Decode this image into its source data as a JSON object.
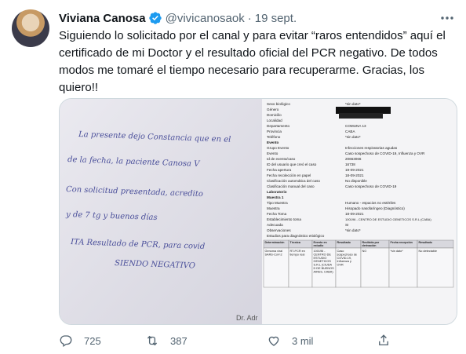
{
  "tweet": {
    "author_name": "Viviana Canosa",
    "handle": "@vivicanosaok",
    "separator": "·",
    "date": "19 sept.",
    "text": "Siguiendo lo solicitado por el canal y para evitar “raros entendidos” aquí el certificado de mi Doctor y el resultado oficial del PCR negativo. De todos modos me tomaré el tiempo necesario para recuperarme. Gracias, los quiero!!"
  },
  "media": {
    "handwriting_lines": [
      "La presente dejo Constancia que en el",
      "de la fecha, la paciente Canosa V",
      "Con solicitud presentada, acredito",
      "y de 7 tg y buenos días",
      "ITA Resultado de PCR, para covid",
      "SIENDO NEGATIVO"
    ],
    "signature": "Dr. Adr",
    "report": {
      "fields_top": [
        {
          "label": "Sexo biológico",
          "value": "*sin dato*"
        },
        {
          "label": "Género",
          "value": ""
        },
        {
          "label": "Domicilio",
          "value": ""
        },
        {
          "label": "Localidad",
          "value": ""
        },
        {
          "label": "Departamento",
          "value": "COMUNA 13"
        },
        {
          "label": "Provincia",
          "value": "CABA"
        },
        {
          "label": "Teléfono",
          "value": "*sin dato*"
        }
      ],
      "section_evento": "Evento",
      "fields_evento": [
        {
          "label": "Grupo Evento",
          "value": "Infecciones respiratorias agudas"
        },
        {
          "label": "Evento",
          "value": "Caso sospechoso de COVID-19, Influenza y OVR"
        },
        {
          "label": "Id de evento/caso",
          "value": "20663066"
        },
        {
          "label": "ID del usuario que creó el caso",
          "value": "16738"
        },
        {
          "label": "Fecha apertura",
          "value": "19-09-2021"
        },
        {
          "label": "Fecha recolección en papel",
          "value": "18-09-2021"
        },
        {
          "label": "Clasificación automática del caso",
          "value": "No disponible"
        },
        {
          "label": "Clasificación manual del caso",
          "value": "Caso sospechoso de COVID-19"
        }
      ],
      "section_lab": "Laboratorio",
      "subsection": "Muestra 1",
      "fields_lab": [
        {
          "label": "Tipo Muestra",
          "value": "Humano - espacios no estériles"
        },
        {
          "label": "Muestra",
          "value": "Hisopado nasofaríngeo (Diagnóstico)"
        },
        {
          "label": "Fecha Toma",
          "value": "18-09-2021"
        },
        {
          "label": "Establecimiento toma",
          "value": "100196 - CENTRO DE ESTUDIO GENETICOS S.R.L (CABA)"
        },
        {
          "label": "Adecuada",
          "value": "SI"
        },
        {
          "label": "Observaciones",
          "value": "*sin dato*"
        }
      ],
      "table_caption": "Estudios para diagnóstico etiológico",
      "table_headers": [
        "Determinación",
        "Técnica",
        "Evento en estudio",
        "Resultado",
        "Recibida por derivación",
        "Fecha recepción",
        "Resultado"
      ],
      "table_row": [
        "Genoma viral SARS-CoV-2",
        "RT-PCR en tiempo real",
        "100196 - CENTRO DE ESTUDIO GENETICOS S.R.L (CIUDA D DE BUENOS AIRES, CABA)",
        "Caso sospechoso de COVID-19, Influenza y OVR",
        "NO",
        "*sin dato*",
        "No detectable"
      ]
    }
  },
  "actions": {
    "reply_count": "725",
    "retweet_count": "387",
    "like_count": "3 mil",
    "share_label": ""
  },
  "colors": {
    "text": "#0f1419",
    "secondary": "#536471",
    "verified": "#1d9bf0",
    "border": "#cfd9de",
    "ink": "#3b3f8f"
  }
}
